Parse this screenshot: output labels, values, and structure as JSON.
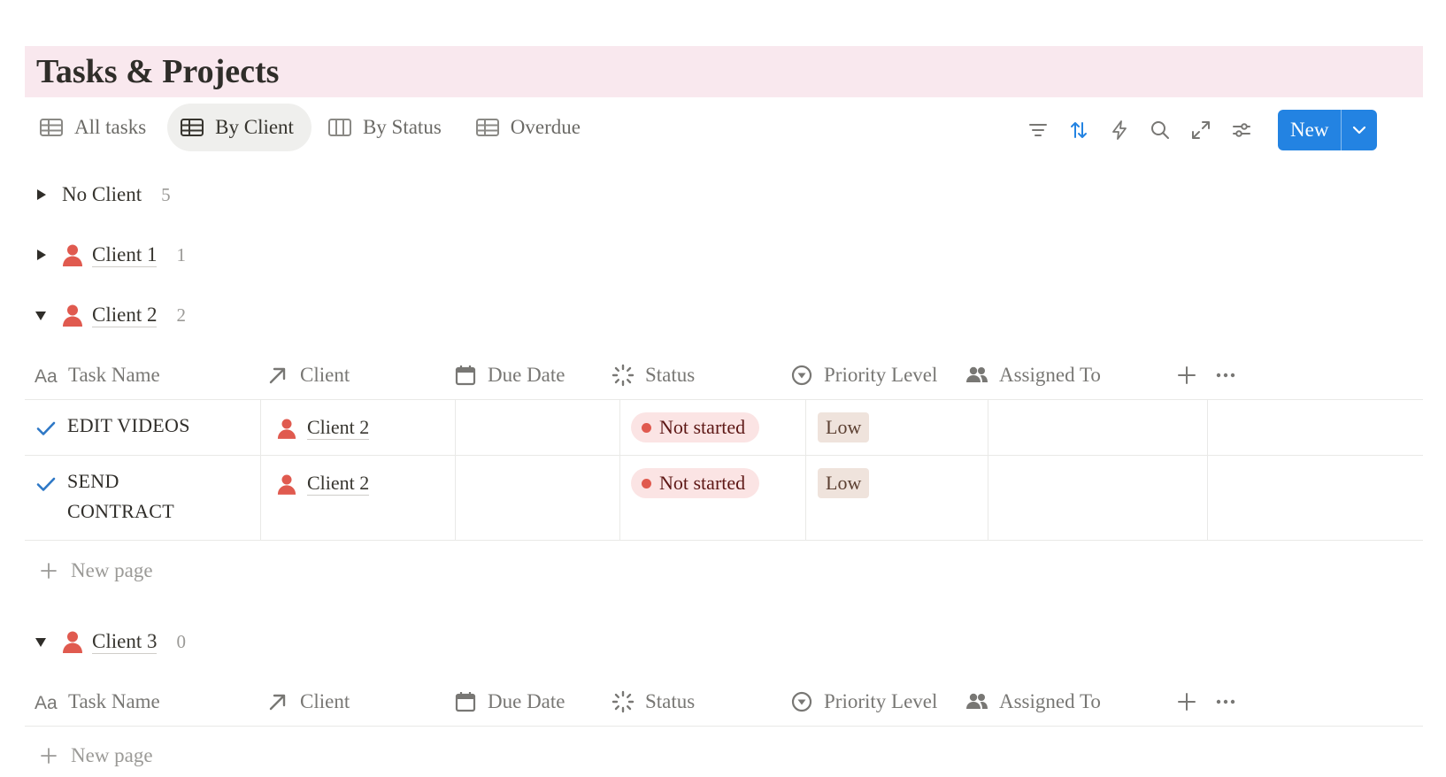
{
  "page": {
    "title": "Tasks & Projects"
  },
  "views": [
    {
      "label": "All tasks",
      "icon": "table-icon",
      "active": false
    },
    {
      "label": "By Client",
      "icon": "table-icon",
      "active": true
    },
    {
      "label": "By Status",
      "icon": "board-icon",
      "active": false
    },
    {
      "label": "Overdue",
      "icon": "table-icon",
      "active": false
    }
  ],
  "toolbar": {
    "icons": [
      "filter-icon",
      "sort-icon",
      "automation-icon",
      "search-icon",
      "expand-icon",
      "settings-icon"
    ],
    "new_label": "New"
  },
  "colors": {
    "title_band": "#f9e8ee",
    "accent": "#2383e2",
    "person_icon": "#e05a4f",
    "status_not_started_bg": "#fbe4e4",
    "status_dot": "#e05a4f",
    "priority_low_bg": "#efe3dc"
  },
  "columns": [
    {
      "label": "Task Name",
      "icon": "text-icon"
    },
    {
      "label": "Client",
      "icon": "relation-arrow-icon"
    },
    {
      "label": "Due Date",
      "icon": "calendar-icon"
    },
    {
      "label": "Status",
      "icon": "status-icon"
    },
    {
      "label": "Priority Level",
      "icon": "select-icon"
    },
    {
      "label": "Assigned To",
      "icon": "people-icon"
    }
  ],
  "groups": [
    {
      "name": "No Client",
      "count": "5",
      "expanded": false
    },
    {
      "name": "Client 1",
      "count": "1",
      "expanded": false
    },
    {
      "name": "Client 2",
      "count": "2",
      "expanded": true,
      "rows": [
        {
          "task": "EDIT VIDEOS",
          "client": "Client 2",
          "due": "",
          "status": "Not started",
          "priority": "Low",
          "assigned": ""
        },
        {
          "task": "SEND CONTRACT",
          "client": "Client 2",
          "due": "",
          "status": "Not started",
          "priority": "Low",
          "assigned": ""
        }
      ],
      "new_page_label": "New page"
    },
    {
      "name": "Client 3",
      "count": "0",
      "expanded": true,
      "rows": [],
      "new_page_label": "New page"
    }
  ]
}
